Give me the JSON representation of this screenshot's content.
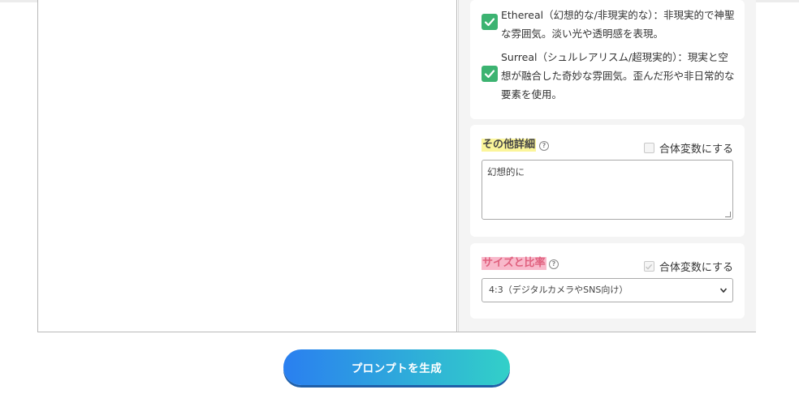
{
  "mood": {
    "items": [
      {
        "text": "Ethereal（幻想的な/非現実的な）：非現実的で神聖な雰囲気。淡い光や透明感を表現。",
        "checked": true
      },
      {
        "text": "Surreal（シュルレアリスム/超現実的）：現実と空想が融合した奇妙な雰囲気。歪んだ形や非日常的な要素を使用。",
        "checked": true
      }
    ]
  },
  "other_details": {
    "label": "その他詳細",
    "help_icon": "?",
    "variable_label": "合体変数にする",
    "value": "幻想的に"
  },
  "size_ratio": {
    "label": "サイズと比率",
    "help_icon": "?",
    "variable_label": "合体変数にする",
    "selected": "4:3（デジタルカメラやSNS向け）"
  },
  "generate_button": {
    "label": "プロンプトを生成"
  },
  "colors": {
    "check_green": "#3cb371",
    "highlight_yellow": "#fbf59a",
    "highlight_pink": "#f8b9cb",
    "button_gradient_start": "#2a7ff0",
    "button_gradient_end": "#32d0c8"
  }
}
